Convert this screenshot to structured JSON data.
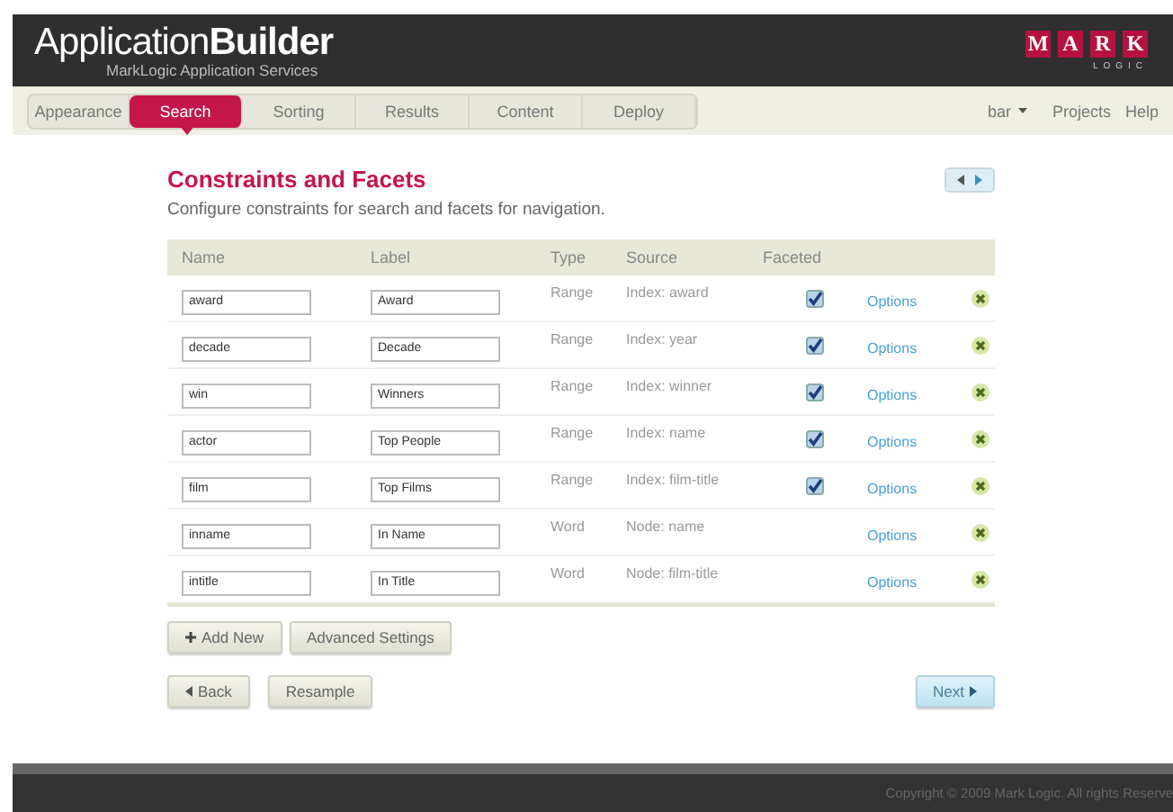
{
  "header": {
    "title_light": "Application",
    "title_bold": "Builder",
    "subtitle": "MarkLogic Application Services",
    "logo_letters": [
      "M",
      "A",
      "R",
      "K"
    ],
    "logo_sub": "LOGIC"
  },
  "nav": {
    "tabs": [
      {
        "label": "Appearance",
        "selected": false
      },
      {
        "label": "Search",
        "selected": true
      },
      {
        "label": "Sorting",
        "selected": false
      },
      {
        "label": "Results",
        "selected": false
      },
      {
        "label": "Content",
        "selected": false
      },
      {
        "label": "Deploy",
        "selected": false
      }
    ],
    "user_menu": "bar",
    "links": [
      "Projects",
      "Help"
    ]
  },
  "page": {
    "title": "Constraints and Facets",
    "description": "Configure constraints for search and facets for navigation."
  },
  "table": {
    "columns": [
      "Name",
      "Label",
      "Type",
      "Source",
      "Faceted"
    ],
    "rows": [
      {
        "name": "award",
        "label": "Award",
        "type": "Range",
        "source": "Index: award",
        "faceted": true,
        "options": "Options"
      },
      {
        "name": "decade",
        "label": "Decade",
        "type": "Range",
        "source": "Index: year",
        "faceted": true,
        "options": "Options"
      },
      {
        "name": "win",
        "label": "Winners",
        "type": "Range",
        "source": "Index: winner",
        "faceted": true,
        "options": "Options"
      },
      {
        "name": "actor",
        "label": "Top People",
        "type": "Range",
        "source": "Index: name",
        "faceted": true,
        "options": "Options"
      },
      {
        "name": "film",
        "label": "Top Films",
        "type": "Range",
        "source": "Index: film-title",
        "faceted": true,
        "options": "Options"
      },
      {
        "name": "inname",
        "label": "In Name",
        "type": "Word",
        "source": "Node: name",
        "faceted": false,
        "options": "Options"
      },
      {
        "name": "intitle",
        "label": "In Title",
        "type": "Word",
        "source": "Node: film-title",
        "faceted": false,
        "options": "Options"
      }
    ]
  },
  "actions": [
    "Add New",
    "Advanced Settings"
  ],
  "back": "Back",
  "resample": "Resample",
  "next": "Next",
  "footer": "Copyright © 2009 Mark Logic. All rights Reserve"
}
